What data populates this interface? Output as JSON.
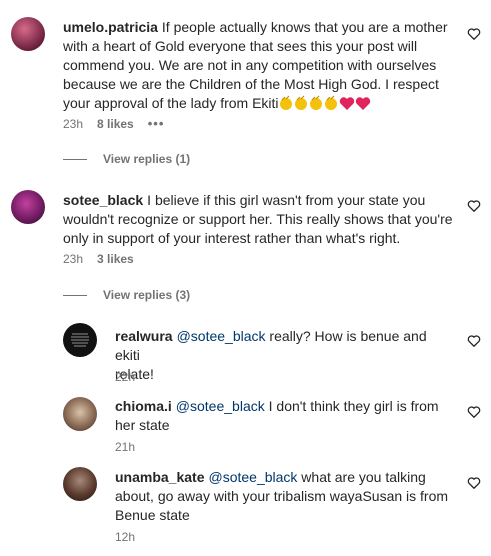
{
  "comments": [
    {
      "username": "umelo.patricia",
      "text": "If people actually knows that you are a mother with a heart of Gold everyone that sees this your post will commend you. We are not in any competition with ourselves because we are the Children of the Most High God. I respect your approval of the lady from Ekiti",
      "emojis": [
        "clap",
        "clap",
        "clap",
        "clap",
        "heart",
        "heart"
      ],
      "time": "23h",
      "likes": "8 likes",
      "more": "•••",
      "view_replies": "View replies (1)"
    },
    {
      "username": "sotee_black",
      "text": "I believe if this girl wasn't from your state you wouldn't recognize or support her. This really shows that you're only in support of your interest rather than what's right.",
      "time": "23h",
      "likes": "3 likes",
      "view_replies": "View replies (3)"
    }
  ],
  "replies": [
    {
      "username": "realwura",
      "mention": "@sotee_black",
      "text_line1": " really? How is benue and ekiti",
      "text_line2": "relate!",
      "time": "22h"
    },
    {
      "username": "chioma.i",
      "mention": "@sotee_black",
      "text_line1": " I don't think they girl is from",
      "text_line2": "her state",
      "time": "21h"
    },
    {
      "username": "unamba_kate",
      "mention": "@sotee_black",
      "text_line1": " what are you talking",
      "text_line2": "about, go away with your tribalism wayaSusan is from",
      "text_line3": "Benue state",
      "time": "12h"
    }
  ],
  "colors": {
    "text": "#262626",
    "secondary": "#737373",
    "mention": "#00376b",
    "emoji_heart": "#e0245e",
    "emoji_clap": "#f4c20d"
  },
  "icons": [
    "heart-outline-icon",
    "clap-emoji",
    "red-heart-emoji",
    "more-options-icon"
  ]
}
